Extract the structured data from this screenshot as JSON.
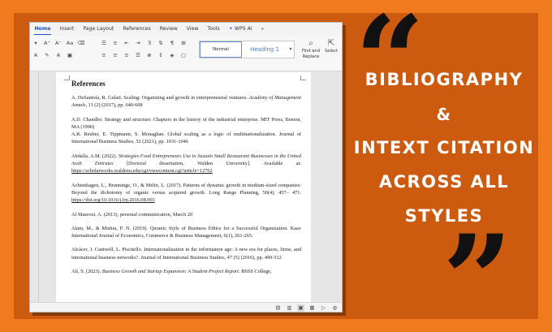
{
  "tabs": [
    "Home",
    "Insert",
    "Page Layout",
    "References",
    "Review",
    "View",
    "Tools",
    "WPS AI"
  ],
  "active_tab": "Home",
  "ribbon": {
    "style_normal": "Normal",
    "style_heading": "Heading 1",
    "find_label": "Find and Replace",
    "select_label": "Select"
  },
  "document": {
    "title": "References",
    "references": [
      {
        "plain": "A. DeSantola, R. Gulati. Scaling: Organizing and growth in entrepreneurial ventures. ",
        "italic": "Academy of Management Annals",
        "tail": ", 11 (2) (2017), pp. 640-668"
      },
      {
        "plain": "A.D. Chandler. Strategy and structure: Chapters in the history of the industrial enterprise. MIT Press, Boston, MA (1990)",
        "italic": "",
        "tail": ""
      },
      {
        "plain": "A.R. Reuber, E. Tippmann, S. Monaghan. Global scaling as a logic of multinationalization. Journal of International Business Studies, 52 (2021), pp. 1031-1046",
        "italic": "",
        "tail": ""
      },
      {
        "plain": "Abdalla, A.M. (2022). ",
        "italic": "Strategies Food Entrepreneurs Use to Sustain Small Restaurant Businesses in the United Arab Emirates",
        "tail": " [Doctoral dissertation, Walden University]. Available at: ",
        "url": "https://scholarworks.waldenu.edu/cgi/viewcontent.cgi?article=12762"
      },
      {
        "plain": "Achtenhagen, L., Brunninge, O., & Melin, L. (2017). Patterns of dynamic growth in medium-sized companies: Beyond the dichotomy of organic versus acquired growth. Long Range Planning, 50(4), 457– 471. ",
        "italic": "",
        "tail": "",
        "url": "https://doi.org/10.1016/j.lrp.2016.08.003"
      },
      {
        "plain": "Al Mazroui, A. (2013), personal communication, March 20",
        "italic": "",
        "tail": ""
      },
      {
        "plain": "Alam, M., & Mishra, P. N. (2019). Quranic Style of Business Ethics for a Successful Organization. Kaav International Journal of Economics, Commerce & Business Management, 6(1), 261-265.",
        "italic": "",
        "tail": ""
      },
      {
        "plain": "Alcácer, J. Cantwell, L. Piscitello. Internationalization in the information age: A new era for places, firms, and international business networks?. Journal of International Business Studies, 47 (5) (2016), pp. 499-512",
        "italic": "",
        "tail": ""
      },
      {
        "plain": "Ali, S. (2023). ",
        "italic": "Business Growth and Startup Expansion: A Student Project Report",
        "tail": ". BSSS College,"
      }
    ]
  },
  "promo": {
    "line1": "BIBLIOGRAPHY",
    "line2": "&",
    "line3": "INTEXT CITATION",
    "line4": "ACROSS ALL",
    "line5": "STYLES",
    "quote_open": "“",
    "quote_close": "”"
  },
  "colors": {
    "background": "#f07a1e",
    "frame": "#cc5b0f",
    "accent": "#1a56c8"
  }
}
